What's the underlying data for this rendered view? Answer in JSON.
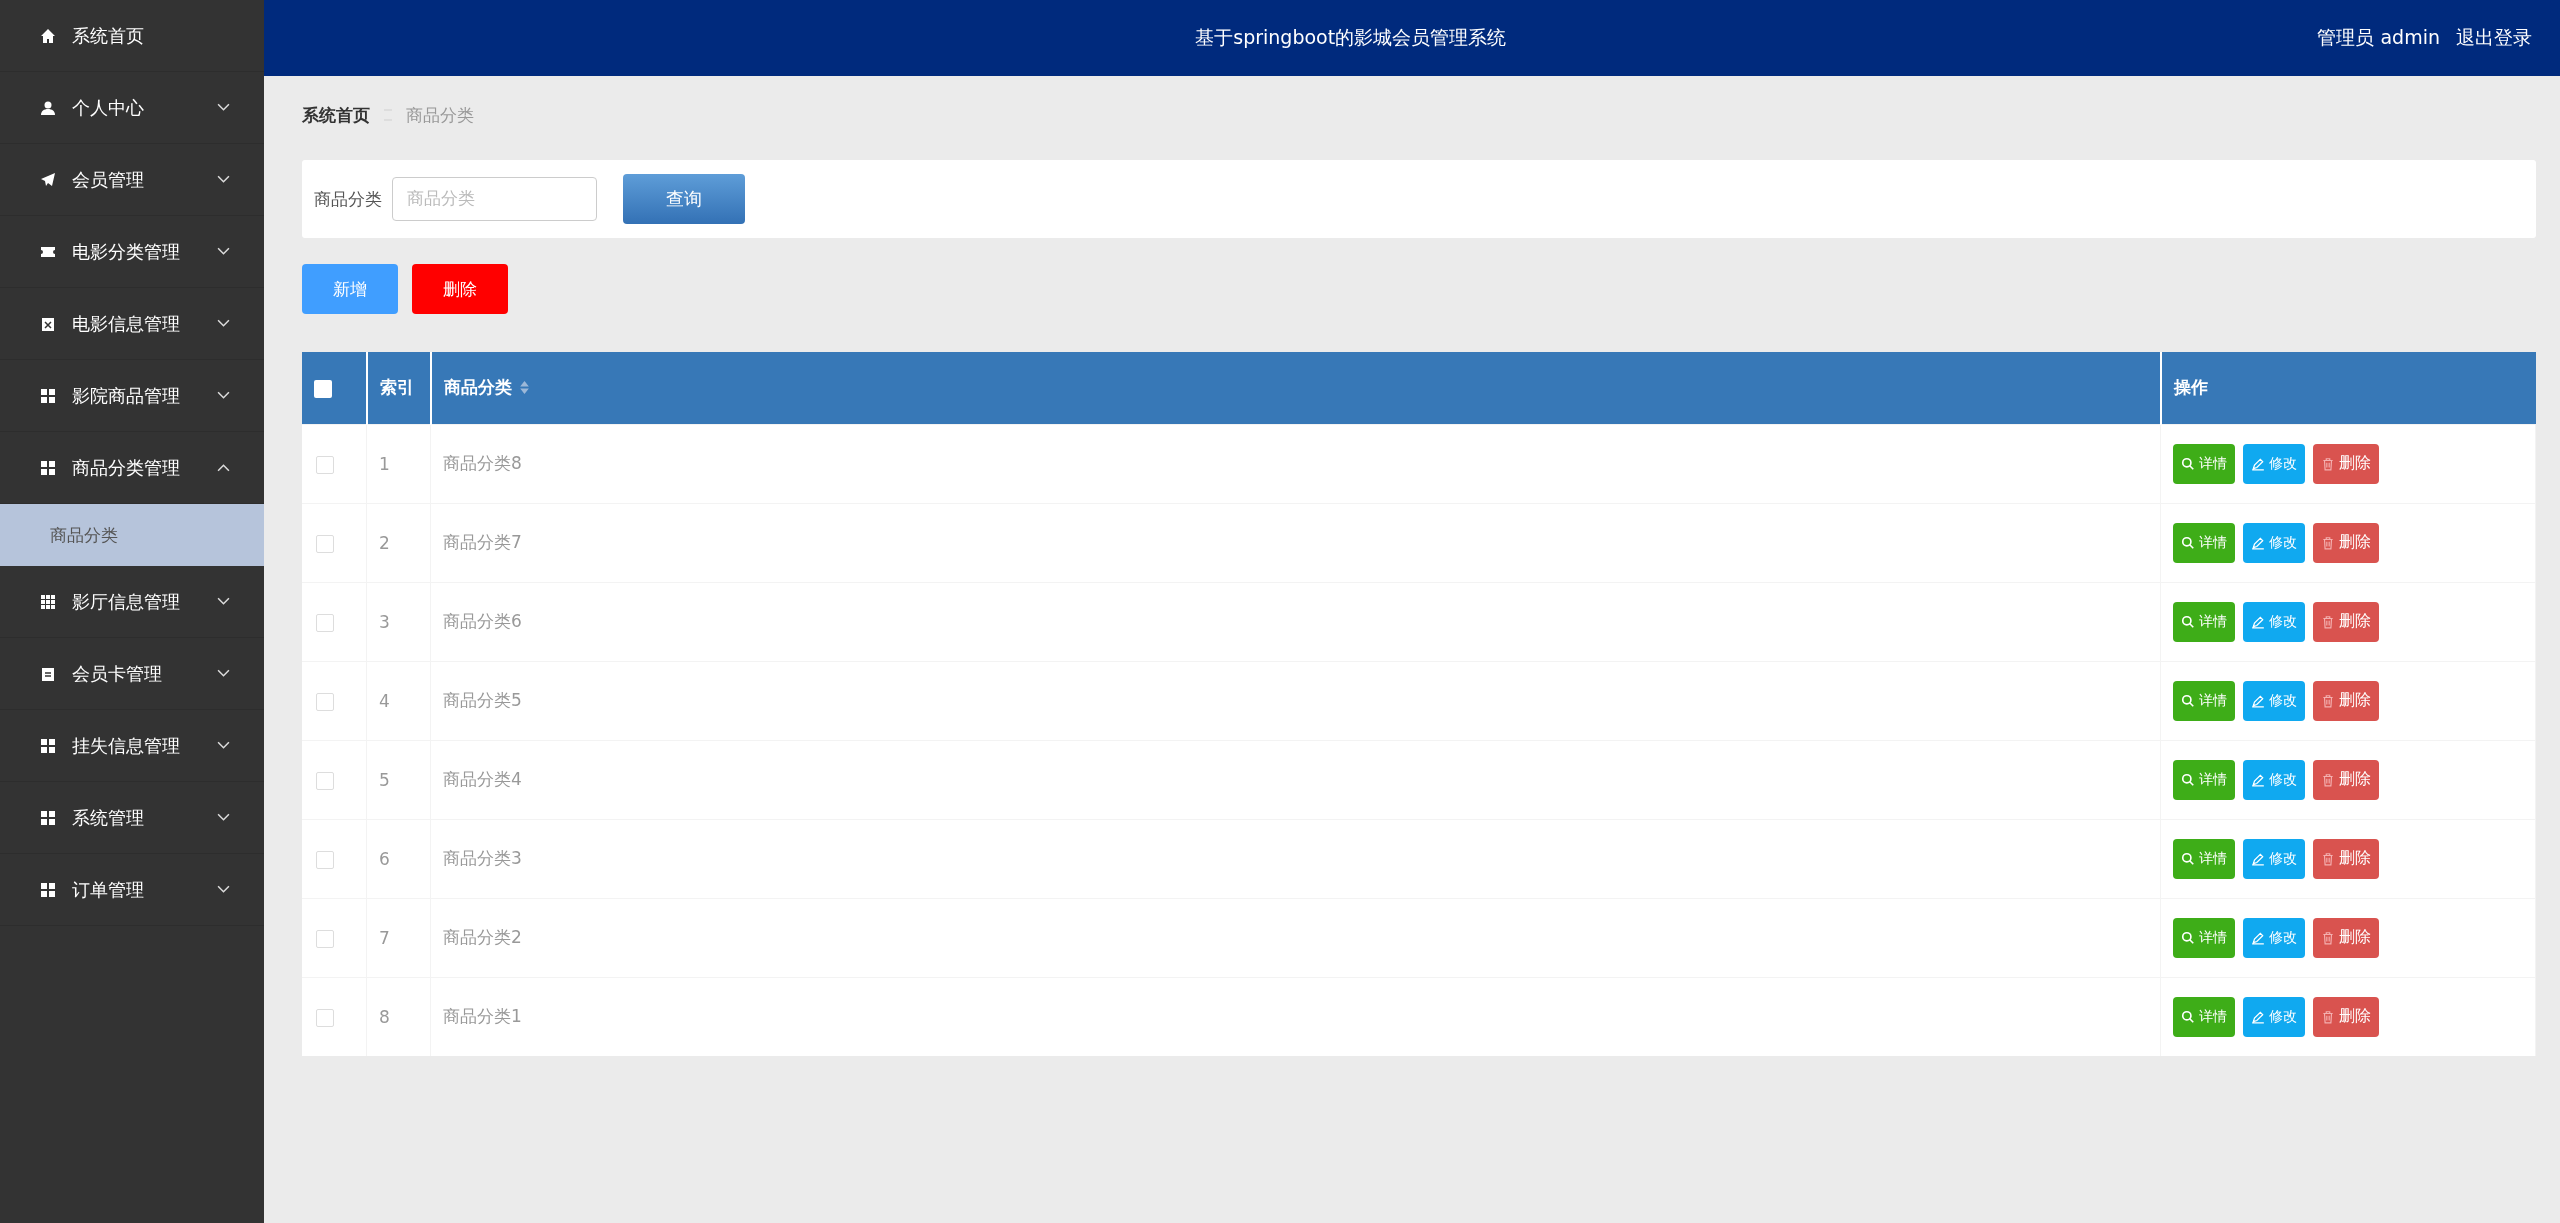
{
  "header": {
    "title": "基于springboot的影城会员管理系统",
    "user": "管理员 admin",
    "logout": "退出登录"
  },
  "sidebar": {
    "items": [
      {
        "label": "系统首页",
        "kind": "link"
      },
      {
        "label": "个人中心",
        "kind": "menu",
        "expanded": false
      },
      {
        "label": "会员管理",
        "kind": "menu",
        "expanded": false
      },
      {
        "label": "电影分类管理",
        "kind": "menu",
        "expanded": false
      },
      {
        "label": "电影信息管理",
        "kind": "menu",
        "expanded": false
      },
      {
        "label": "影院商品管理",
        "kind": "menu",
        "expanded": false
      },
      {
        "label": "商品分类管理",
        "kind": "menu",
        "expanded": true,
        "children": [
          {
            "label": "商品分类",
            "selected": true
          }
        ]
      },
      {
        "label": "影厅信息管理",
        "kind": "menu",
        "expanded": false
      },
      {
        "label": "会员卡管理",
        "kind": "menu",
        "expanded": false
      },
      {
        "label": "挂失信息管理",
        "kind": "menu",
        "expanded": false
      },
      {
        "label": "系统管理",
        "kind": "menu",
        "expanded": false
      },
      {
        "label": "订单管理",
        "kind": "menu",
        "expanded": false
      }
    ]
  },
  "breadcrumb": [
    "系统首页",
    "商品分类"
  ],
  "search": {
    "label": "商品分类",
    "placeholder": "商品分类",
    "button": "查询"
  },
  "actions": {
    "add": "新增",
    "delete": "删除"
  },
  "table": {
    "select_all": {
      "checked": false
    },
    "columns": [
      "索引",
      "商品分类",
      "操作"
    ],
    "rows": [
      {
        "index": "1",
        "name": "商品分类8",
        "checked": false,
        "buttons": [
          "详情",
          "修改",
          "删除"
        ]
      },
      {
        "index": "2",
        "name": "商品分类7",
        "checked": false,
        "buttons": [
          "详情",
          "修改",
          "删除"
        ]
      },
      {
        "index": "3",
        "name": "商品分类6",
        "checked": false,
        "buttons": [
          "详情",
          "修改",
          "删除"
        ]
      },
      {
        "index": "4",
        "name": "商品分类5",
        "checked": false,
        "buttons": [
          "详情",
          "修改",
          "删除"
        ]
      },
      {
        "index": "5",
        "name": "商品分类4",
        "checked": false,
        "buttons": [
          "详情",
          "修改",
          "删除"
        ]
      },
      {
        "index": "6",
        "name": "商品分类3",
        "checked": false,
        "buttons": [
          "详情",
          "修改",
          "删除"
        ]
      },
      {
        "index": "7",
        "name": "商品分类2",
        "checked": false,
        "buttons": [
          "详情",
          "修改",
          "删除"
        ]
      },
      {
        "index": "8",
        "name": "商品分类1",
        "checked": false,
        "buttons": [
          "详情",
          "修改",
          "删除"
        ]
      }
    ]
  }
}
